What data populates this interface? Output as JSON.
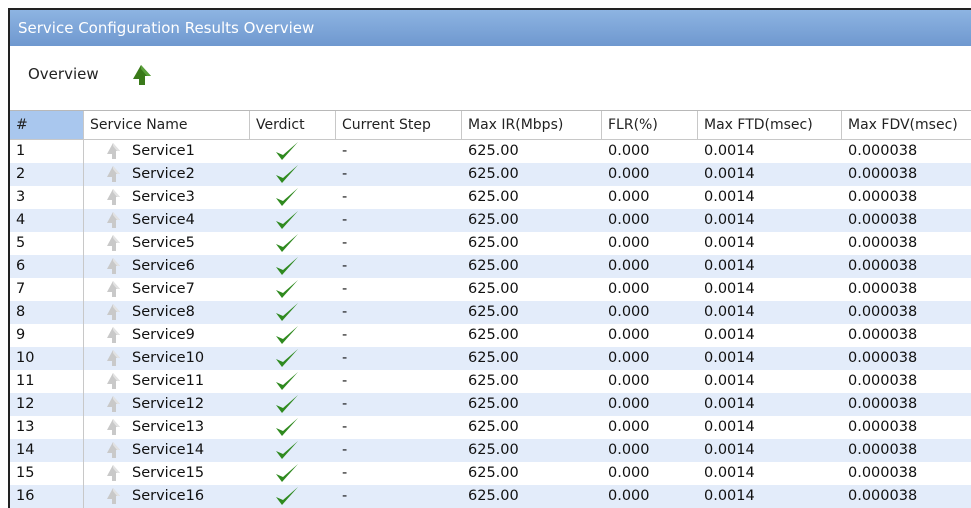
{
  "window": {
    "title": "Service Configuration Results Overview"
  },
  "toolbar": {
    "label": "Overview",
    "home_icon": "up-arrow-icon"
  },
  "table": {
    "headers": [
      "#",
      "Service Name",
      "Verdict",
      "Current Step",
      "Max IR(Mbps)",
      "FLR(%)",
      "Max FTD(msec)",
      "Max FDV(msec)"
    ],
    "rows": [
      {
        "num": "1",
        "name": "Service1",
        "verdict": "pass",
        "step": "-",
        "ir": "625.00",
        "flr": "0.000",
        "ftd": "0.0014",
        "fdv": "0.000038"
      },
      {
        "num": "2",
        "name": "Service2",
        "verdict": "pass",
        "step": "-",
        "ir": "625.00",
        "flr": "0.000",
        "ftd": "0.0014",
        "fdv": "0.000038"
      },
      {
        "num": "3",
        "name": "Service3",
        "verdict": "pass",
        "step": "-",
        "ir": "625.00",
        "flr": "0.000",
        "ftd": "0.0014",
        "fdv": "0.000038"
      },
      {
        "num": "4",
        "name": "Service4",
        "verdict": "pass",
        "step": "-",
        "ir": "625.00",
        "flr": "0.000",
        "ftd": "0.0014",
        "fdv": "0.000038"
      },
      {
        "num": "5",
        "name": "Service5",
        "verdict": "pass",
        "step": "-",
        "ir": "625.00",
        "flr": "0.000",
        "ftd": "0.0014",
        "fdv": "0.000038"
      },
      {
        "num": "6",
        "name": "Service6",
        "verdict": "pass",
        "step": "-",
        "ir": "625.00",
        "flr": "0.000",
        "ftd": "0.0014",
        "fdv": "0.000038"
      },
      {
        "num": "7",
        "name": "Service7",
        "verdict": "pass",
        "step": "-",
        "ir": "625.00",
        "flr": "0.000",
        "ftd": "0.0014",
        "fdv": "0.000038"
      },
      {
        "num": "8",
        "name": "Service8",
        "verdict": "pass",
        "step": "-",
        "ir": "625.00",
        "flr": "0.000",
        "ftd": "0.0014",
        "fdv": "0.000038"
      },
      {
        "num": "9",
        "name": "Service9",
        "verdict": "pass",
        "step": "-",
        "ir": "625.00",
        "flr": "0.000",
        "ftd": "0.0014",
        "fdv": "0.000038"
      },
      {
        "num": "10",
        "name": "Service10",
        "verdict": "pass",
        "step": "-",
        "ir": "625.00",
        "flr": "0.000",
        "ftd": "0.0014",
        "fdv": "0.000038"
      },
      {
        "num": "11",
        "name": "Service11",
        "verdict": "pass",
        "step": "-",
        "ir": "625.00",
        "flr": "0.000",
        "ftd": "0.0014",
        "fdv": "0.000038"
      },
      {
        "num": "12",
        "name": "Service12",
        "verdict": "pass",
        "step": "-",
        "ir": "625.00",
        "flr": "0.000",
        "ftd": "0.0014",
        "fdv": "0.000038"
      },
      {
        "num": "13",
        "name": "Service13",
        "verdict": "pass",
        "step": "-",
        "ir": "625.00",
        "flr": "0.000",
        "ftd": "0.0014",
        "fdv": "0.000038"
      },
      {
        "num": "14",
        "name": "Service14",
        "verdict": "pass",
        "step": "-",
        "ir": "625.00",
        "flr": "0.000",
        "ftd": "0.0014",
        "fdv": "0.000038"
      },
      {
        "num": "15",
        "name": "Service15",
        "verdict": "pass",
        "step": "-",
        "ir": "625.00",
        "flr": "0.000",
        "ftd": "0.0014",
        "fdv": "0.000038"
      },
      {
        "num": "16",
        "name": "Service16",
        "verdict": "pass",
        "step": "-",
        "ir": "625.00",
        "flr": "0.000",
        "ftd": "0.0014",
        "fdv": "0.000038"
      }
    ]
  },
  "colors": {
    "title_bar": "#7fa8dc",
    "row_alt": "#e3ecfa",
    "check": "#2f8a1f",
    "home_icon": "#3a7a1a"
  }
}
